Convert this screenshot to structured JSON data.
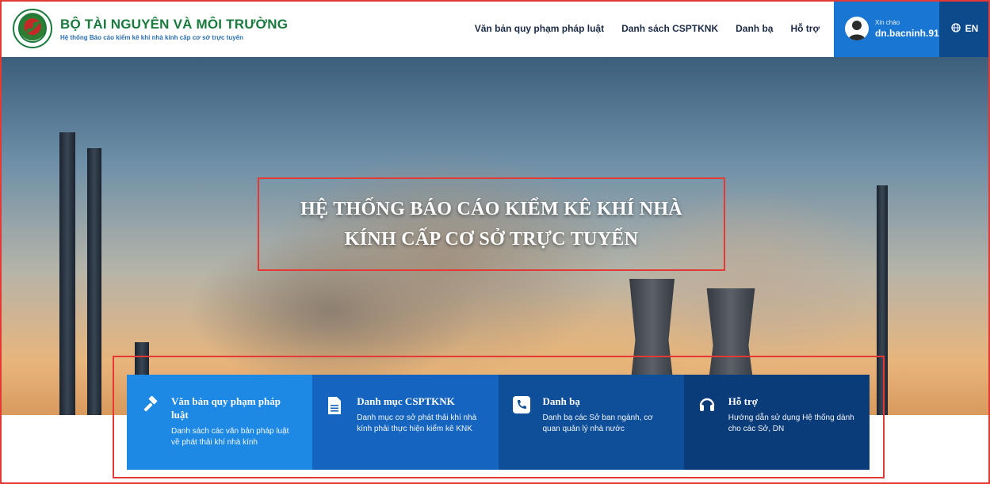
{
  "header": {
    "title": "BỘ TÀI NGUYÊN VÀ MÔI TRƯỜNG",
    "subtitle": "Hệ thống Báo cáo kiểm kê khí nhà kính cấp cơ sở trực tuyến",
    "nav": [
      {
        "label": "Văn bản quy phạm pháp luật"
      },
      {
        "label": "Danh sách CSPTKNK"
      },
      {
        "label": "Danh bạ"
      },
      {
        "label": "Hỗ trợ"
      }
    ],
    "user": {
      "greeting": "Xin chào",
      "name": "dn.bacninh.91"
    },
    "language": "EN",
    "colors": {
      "brand_green": "#1a7a3e",
      "user_bg": "#1976d2",
      "lang_bg": "#0d4a8c"
    }
  },
  "hero": {
    "title_line1": "HỆ THỐNG BÁO CÁO KIỂM KÊ KHÍ NHÀ",
    "title_line2": "KÍNH CẤP CƠ SỞ TRỰC TUYẾN"
  },
  "cards": [
    {
      "icon": "gavel-icon",
      "title": "Văn bản quy phạm pháp luật",
      "desc": "Danh sách các văn bản pháp luật về phát thải khí nhà kính",
      "color": "#1e88e5"
    },
    {
      "icon": "document-icon",
      "title": "Danh mục CSPTKNK",
      "desc": "Danh mục cơ sở phát thải khí nhà kính phải thực hiện kiểm kê KNK",
      "color": "#1565c0"
    },
    {
      "icon": "phone-icon",
      "title": "Danh bạ",
      "desc": "Danh bạ các Sở ban ngành, cơ quan quản lý nhà nước",
      "color": "#0f4f9a"
    },
    {
      "icon": "headset-icon",
      "title": "Hỗ trợ",
      "desc": "Hướng dẫn sử dụng Hệ thống dành cho các Sở, DN",
      "color": "#0b3c7a"
    }
  ]
}
